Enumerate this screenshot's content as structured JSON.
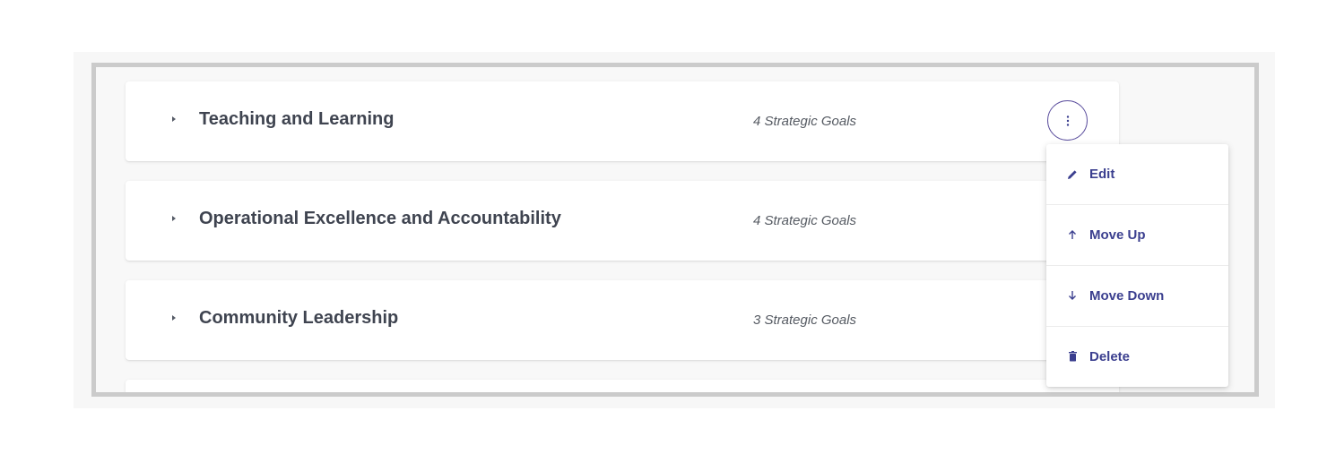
{
  "objectives": [
    {
      "title": "Teaching and Learning",
      "count": "4 Strategic Goals"
    },
    {
      "title": "Operational Excellence and Accountability",
      "count": "4 Strategic Goals"
    },
    {
      "title": "Community Leadership",
      "count": "3 Strategic Goals"
    }
  ],
  "menu": {
    "items": [
      {
        "label": "Edit",
        "icon": "pencil-icon"
      },
      {
        "label": "Move Up",
        "icon": "arrow-up-icon"
      },
      {
        "label": "Move Down",
        "icon": "arrow-down-icon"
      },
      {
        "label": "Delete",
        "icon": "trash-icon"
      }
    ]
  },
  "colors": {
    "accent": "#5c4f9e",
    "menu_text": "#3b3f8f",
    "title_text": "#3f4450",
    "frame_border": "#cbcbcb"
  }
}
